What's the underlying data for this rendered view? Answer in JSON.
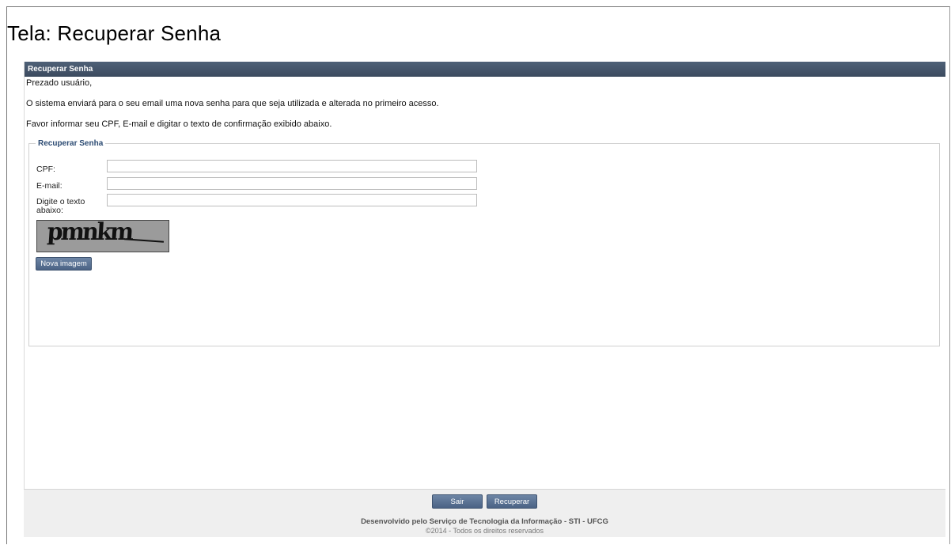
{
  "screen": {
    "title": "Tela: Recuperar Senha"
  },
  "panel": {
    "header": "Recuperar Senha",
    "greeting": "Prezado usuário,",
    "info": "O sistema enviará para o seu email uma nova senha para que seja utilizada e alterada no primeiro acesso.",
    "instruction": "Favor informar seu CPF, E-mail e digitar o texto de confirmação exibido abaixo."
  },
  "form": {
    "legend": "Recuperar Senha",
    "cpf_label": "CPF:",
    "cpf_value": "",
    "email_label": "E-mail:",
    "email_value": "",
    "captcha_label": "Digite o texto abaixo:",
    "captcha_value": "",
    "captcha_image_text": "pmnkm",
    "new_image_label": "Nova imagem"
  },
  "footer": {
    "exit_label": "Sair",
    "recover_label": "Recuperar",
    "credit": "Desenvolvido pelo Serviço de Tecnologia da Informação - STI - UFCG",
    "copyright": "©2014 - Todos os direitos reservados"
  },
  "colors": {
    "header_bg": "#3b4a5e",
    "button_bg": "#5a7396",
    "legend_text": "#2c4b73",
    "footer_bg": "#efefef"
  }
}
